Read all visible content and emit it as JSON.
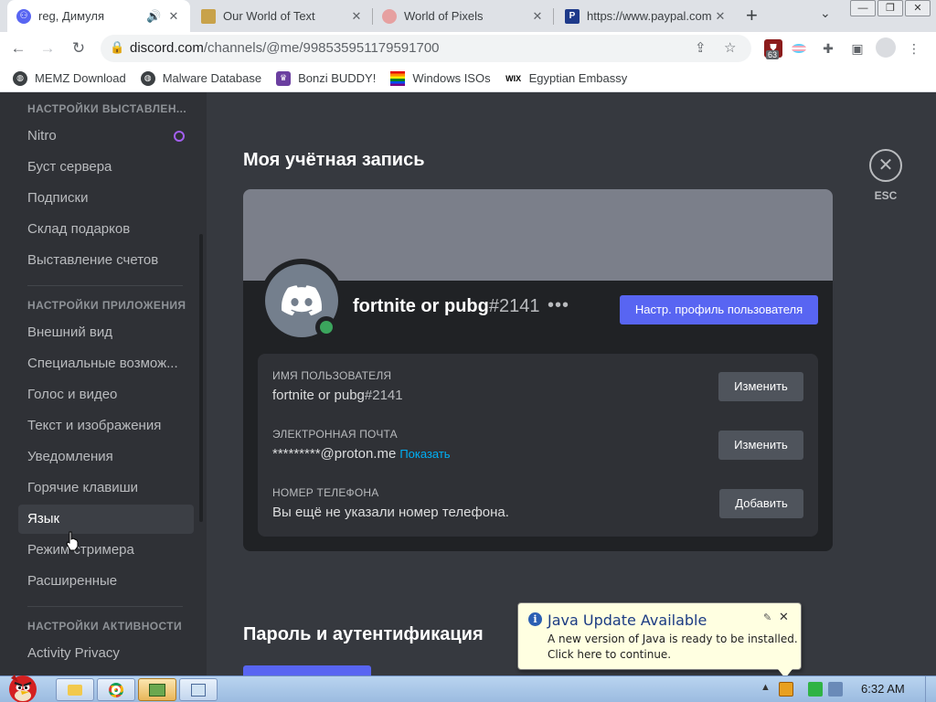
{
  "browser": {
    "tabs": [
      {
        "title": "reg, Димуля",
        "active": true,
        "audio": true,
        "icon": "discord-favicon",
        "color": "#5865f2"
      },
      {
        "title": "Our World of Text",
        "active": false,
        "icon": "owot-favicon",
        "color": "#c8a24a"
      },
      {
        "title": "World of Pixels",
        "active": false,
        "icon": "wop-favicon",
        "color": "#e6a0a0"
      },
      {
        "title": "https://www.paypal.com",
        "active": false,
        "icon": "paypal-favicon",
        "color": "#1e3a8a"
      }
    ],
    "url_host": "discord.com",
    "url_path": "/channels/@me/998535951179591700",
    "extension_badge": "63",
    "bookmarks": [
      {
        "label": "MEMZ Download"
      },
      {
        "label": "Malware Database"
      },
      {
        "label": "Bonzi BUDDY!"
      },
      {
        "label": "Windows ISOs"
      },
      {
        "label": "Egyptian Embassy"
      }
    ]
  },
  "sidebar": {
    "header_billing": "НАСТРОЙКИ ВЫСТАВЛЕН...",
    "billing_items": [
      "Nitro",
      "Буст сервера",
      "Подписки",
      "Склад подарков",
      "Выставление счетов"
    ],
    "header_app": "НАСТРОЙКИ ПРИЛОЖЕНИЯ",
    "app_items": [
      "Внешний вид",
      "Специальные возмож...",
      "Голос и видео",
      "Текст и изображения",
      "Уведомления",
      "Горячие клавиши",
      "Язык",
      "Режим стримера",
      "Расширенные"
    ],
    "selected": "Язык",
    "header_activity": "НАСТРОЙКИ АКТИВНОСТИ",
    "activity_items": [
      "Activity Privacy"
    ]
  },
  "main": {
    "title": "Моя учётная запись",
    "esc_label": "ESC",
    "username": "fortnite or pubg",
    "discriminator": "#2141",
    "edit_profile_label": "Настр. профиль пользователя",
    "fields": {
      "username_label": "ИМЯ ПОЛЬЗОВАТЕЛЯ",
      "username_value": "fortnite or pubg",
      "username_disc": "#2141",
      "username_btn": "Изменить",
      "email_label": "ЭЛЕКТРОННАЯ ПОЧТА",
      "email_value": "*********@proton.me",
      "email_reveal": "Показать",
      "email_btn": "Изменить",
      "phone_label": "НОМЕР ТЕЛЕФОНА",
      "phone_value": "Вы ещё не указали номер телефона.",
      "phone_btn": "Добавить"
    },
    "section2_title": "Пароль и аутентификация",
    "status": "online",
    "colors": {
      "blurple": "#5865f2",
      "online": "#3ba55d",
      "banner": "#7b7f8a"
    }
  },
  "java_popup": {
    "title": "Java Update Available",
    "line1": "A new version of Java is ready to be installed.",
    "line2": "Click here to continue."
  },
  "taskbar": {
    "clock": "6:32 AM"
  }
}
